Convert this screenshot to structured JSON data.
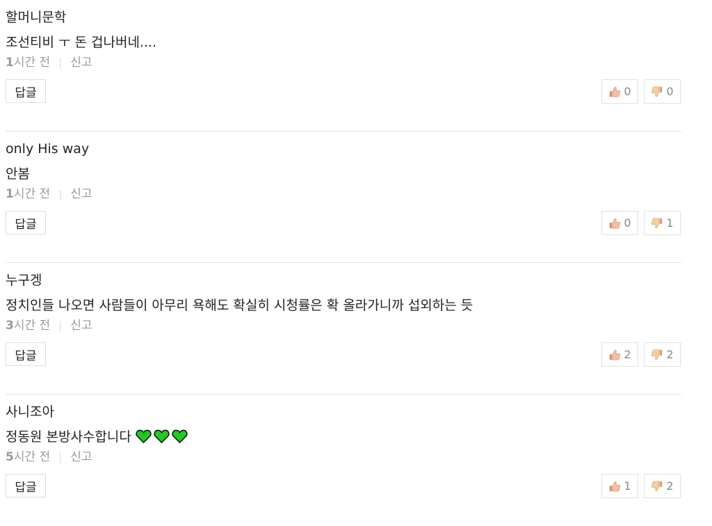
{
  "comments": [
    {
      "author": "할머니문학",
      "text": "조선티비 ㅜ 돈 겁나버네....",
      "time_num": "1",
      "time_unit": "시간 전",
      "report": "신고",
      "reply": "답글",
      "likes": "0",
      "dislikes": "0"
    },
    {
      "author": "only His way",
      "text": "안봄",
      "time_num": "1",
      "time_unit": "시간 전",
      "report": "신고",
      "reply": "답글",
      "likes": "0",
      "dislikes": "1"
    },
    {
      "author": "누구겡",
      "text": "정치인들 나오면 사람들이 아무리 욕해도 확실히 시청률은 확 올라가니까 섭외하는 듯",
      "time_num": "3",
      "time_unit": "시간 전",
      "report": "신고",
      "reply": "답글",
      "likes": "2",
      "dislikes": "2"
    },
    {
      "author": "사니조아",
      "text": "정동원 본방사수합니다",
      "emoji": "green-heart-icon x3",
      "time_num": "5",
      "time_unit": "시간 전",
      "report": "신고",
      "reply": "답글",
      "likes": "1",
      "dislikes": "2"
    }
  ],
  "colors": {
    "text": "#222222",
    "meta": "#999999",
    "divider": "#e3e3e3",
    "button_border": "#dcdcdc",
    "thumb_up": "#e8a88a",
    "thumb_down": "#e8b88a",
    "heart": "#22c91e"
  }
}
